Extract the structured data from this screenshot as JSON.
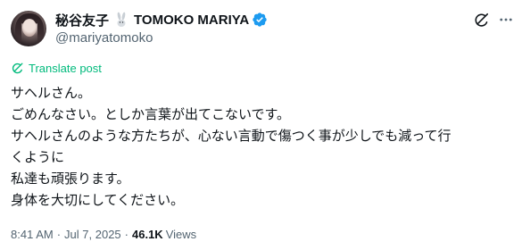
{
  "author": {
    "display_name": "秘谷友子",
    "name_emoji": "rabbit-emoji",
    "display_name_latin": "TOMOKO MARIYA",
    "verified": true,
    "handle": "@mariyatomoko"
  },
  "actions": {
    "grok_icon": "grok-icon",
    "more_icon": "more-icon"
  },
  "translate": {
    "label": "Translate post"
  },
  "post": {
    "lines": [
      "サヘルさん。",
      "ごめんなさい。としか言葉が出てこないです。",
      "サヘルさんのような方たちが、心ない言動で傷つく事が少しでも減って行",
      "くように",
      "私達も頑張ります。",
      "身体を大切にしてください。"
    ]
  },
  "meta": {
    "time": "8:41 AM",
    "separator": "·",
    "date": "Jul 7, 2025",
    "views_count": "46.1K",
    "views_label": "Views"
  },
  "colors": {
    "text": "#0f1419",
    "secondary": "#536471",
    "accent": "#1d9bf0"
  }
}
